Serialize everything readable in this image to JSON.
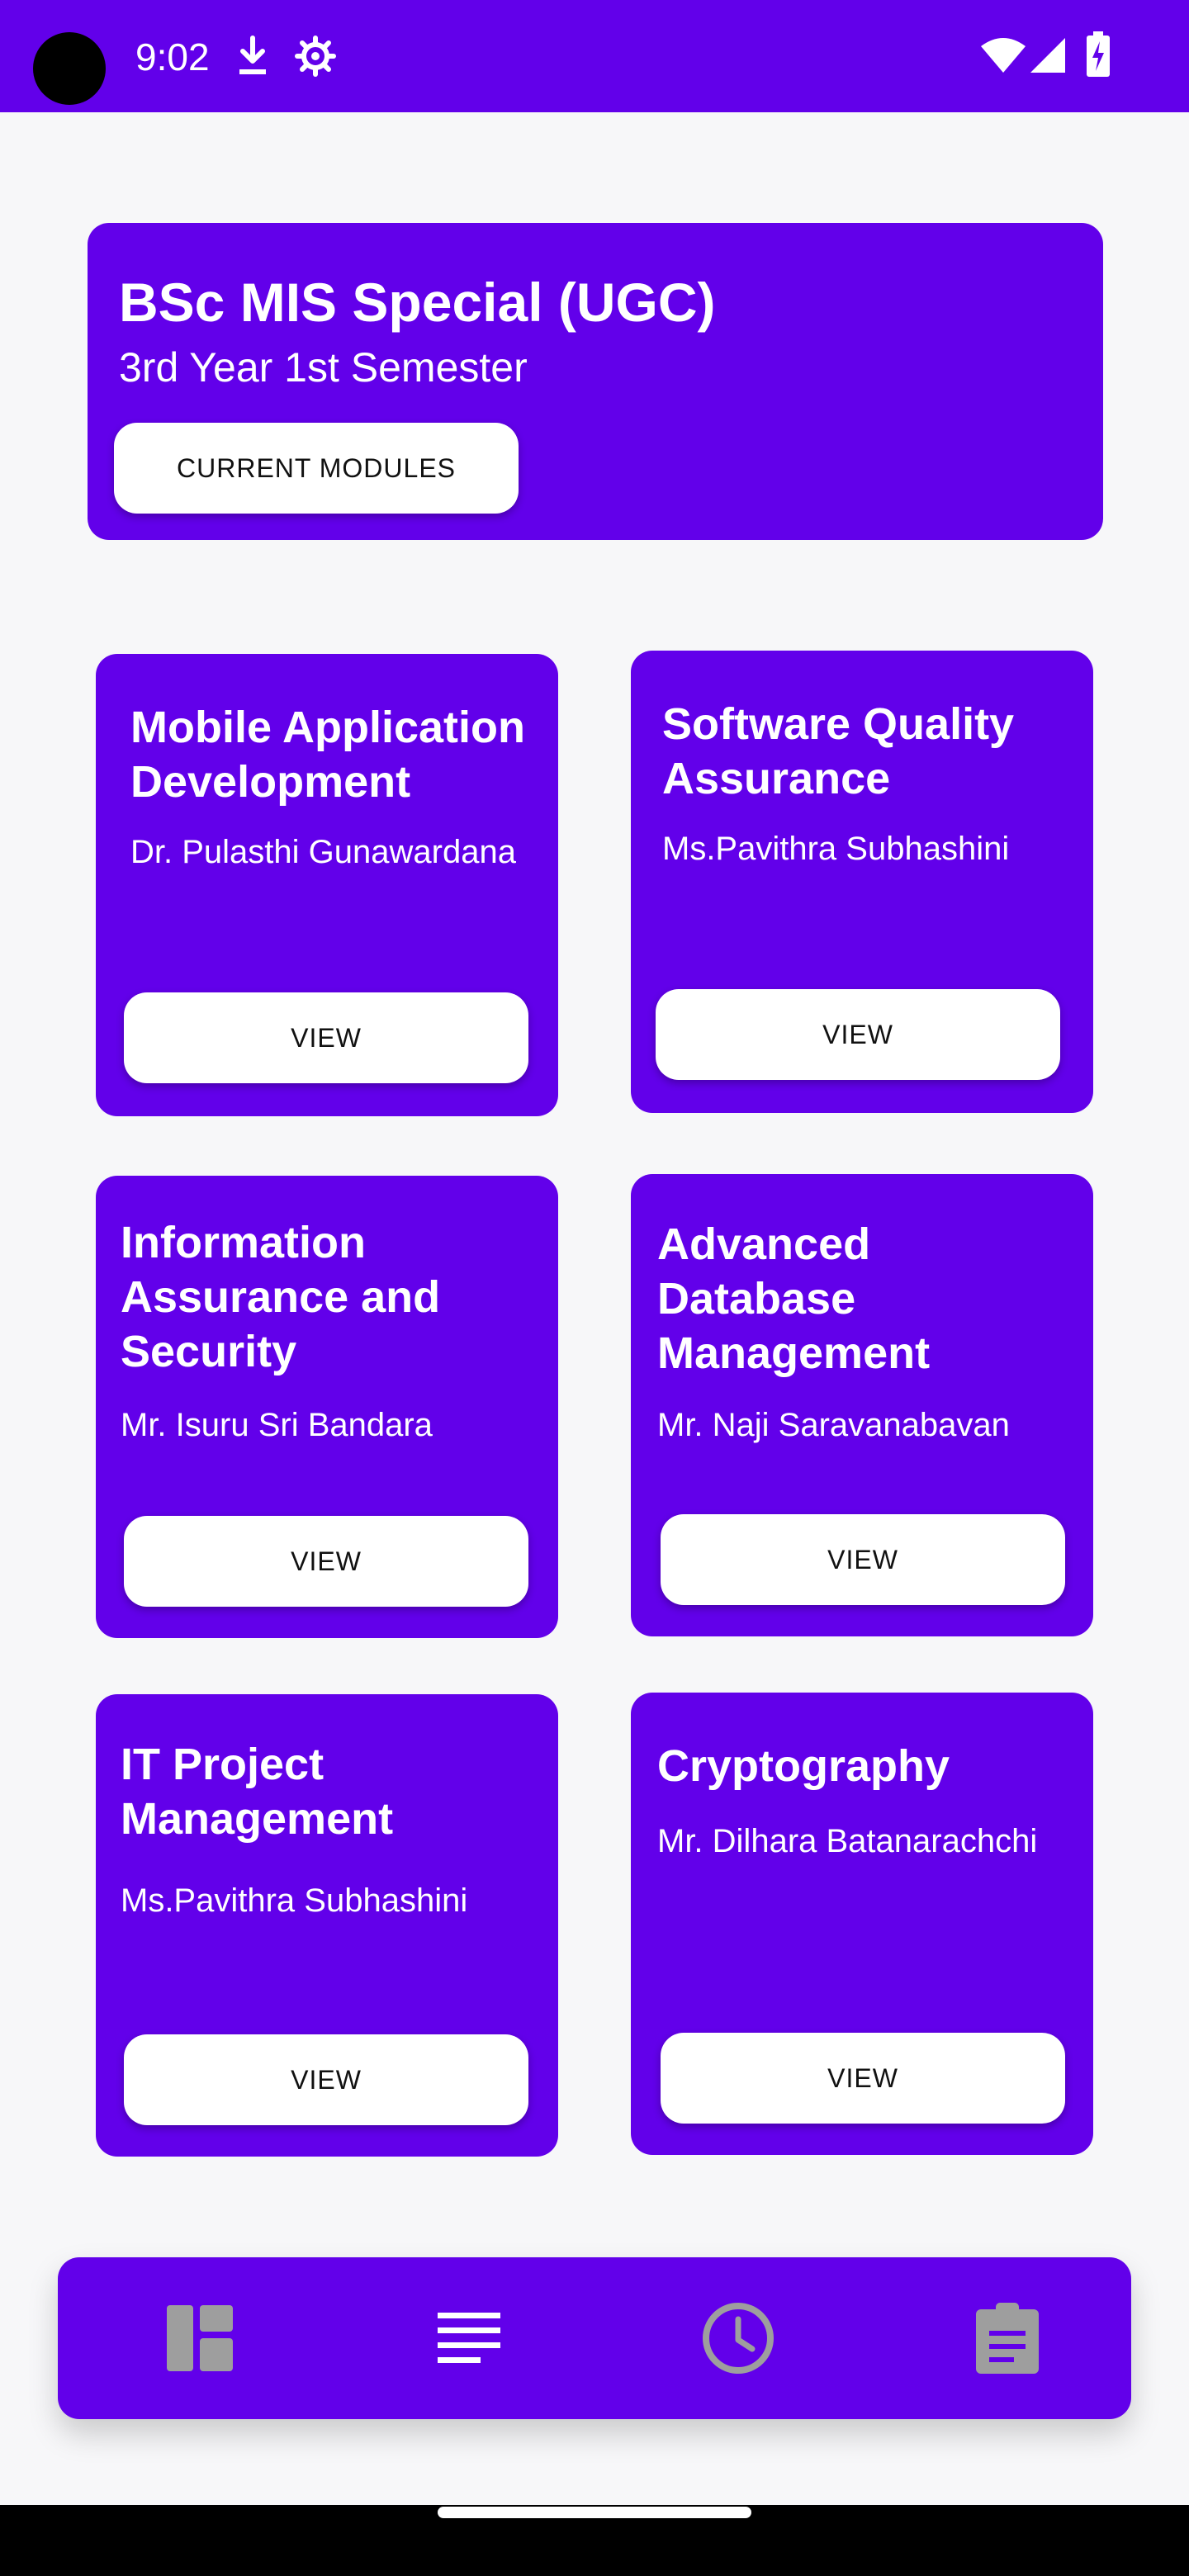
{
  "status_bar": {
    "time": "9:02",
    "left_icons": [
      "download-icon",
      "settings-gear-icon"
    ],
    "right_icons": [
      "wifi-icon",
      "cell-signal-icon",
      "battery-charging-icon"
    ]
  },
  "header": {
    "title": "BSc MIS Special (UGC)",
    "subtitle": "3rd Year 1st Semester",
    "button_label": "CURRENT MODULES"
  },
  "modules": [
    {
      "title": "Mobile Application Development",
      "lecturer": "Dr. Pulasthi Gunawardana",
      "button_label": "VIEW"
    },
    {
      "title": "Software Quality Assurance",
      "lecturer": "Ms.Pavithra Subhashini",
      "button_label": "VIEW"
    },
    {
      "title": "Information Assurance and Security",
      "lecturer": "Mr. Isuru Sri Bandara",
      "button_label": "VIEW"
    },
    {
      "title": "Advanced Database Management",
      "lecturer": "Mr. Naji Saravanabavan",
      "button_label": "VIEW"
    },
    {
      "title": "IT Project Management",
      "lecturer": "Ms.Pavithra Subhashini",
      "button_label": "VIEW"
    },
    {
      "title": "Cryptography",
      "lecturer": "Mr. Dilhara Batanarachchi",
      "button_label": "VIEW"
    }
  ],
  "bottom_nav": {
    "items": [
      {
        "icon": "dashboard-icon",
        "active": false
      },
      {
        "icon": "list-icon",
        "active": true
      },
      {
        "icon": "clock-icon",
        "active": false
      },
      {
        "icon": "assignment-icon",
        "active": false
      }
    ]
  },
  "colors": {
    "primary": "#6200ea",
    "background": "#f7f7f9",
    "button": "#ffffff",
    "nav_inactive": "#9e9e9e",
    "nav_active": "#ffffff"
  }
}
